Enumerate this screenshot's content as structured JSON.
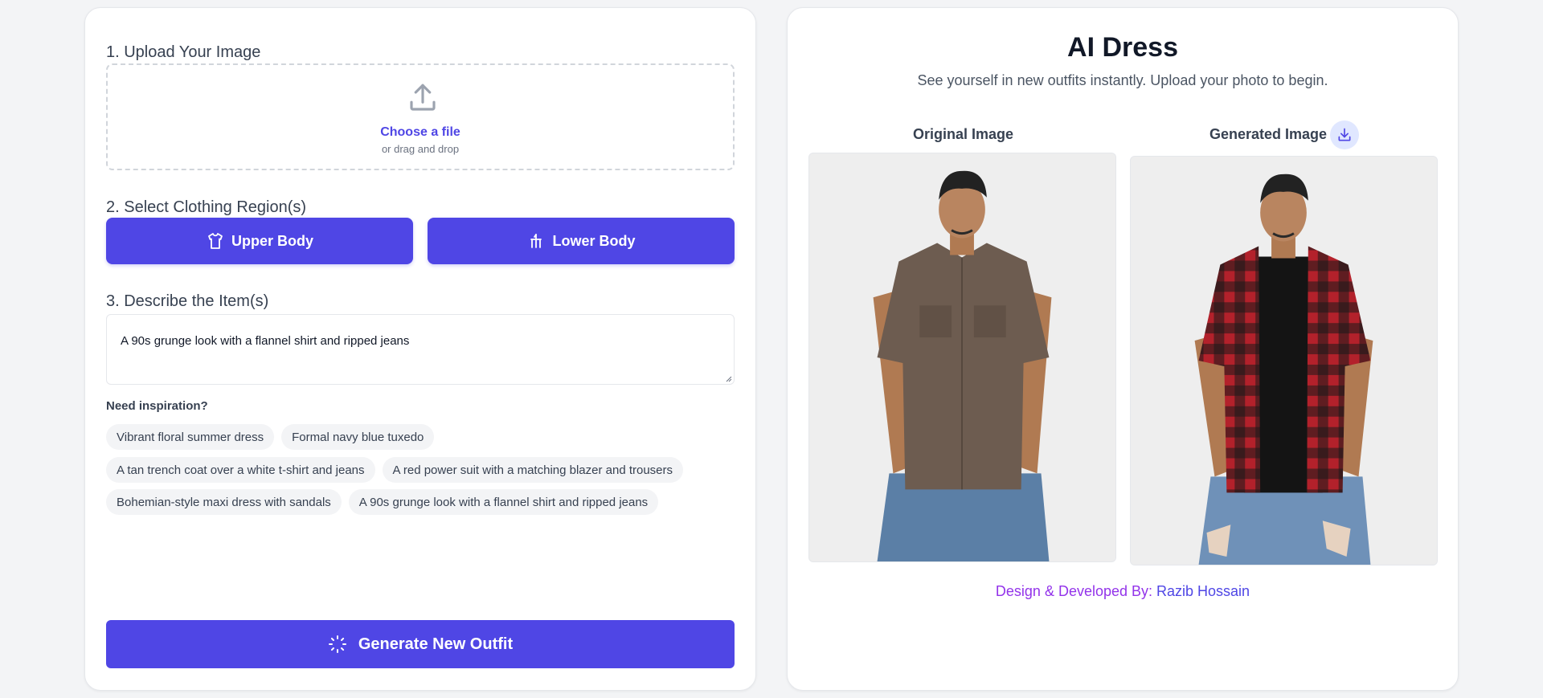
{
  "upload": {
    "title": "1. Upload Your Image",
    "choose_file": "Choose a file",
    "drag_drop": "or drag and drop"
  },
  "regions": {
    "title": "2. Select Clothing Region(s)",
    "upper_label": "Upper Body",
    "lower_label": "Lower Body"
  },
  "describe": {
    "title": "3. Describe the Item(s)",
    "value": "A 90s grunge look with a flannel shirt and ripped jeans"
  },
  "inspiration": {
    "label": "Need inspiration?",
    "chips": [
      "Vibrant floral summer dress",
      "Formal navy blue tuxedo",
      "A tan trench coat over a white t-shirt and jeans",
      "A red power suit with a matching blazer and trousers",
      "Bohemian-style maxi dress with sandals",
      "A 90s grunge look with a flannel shirt and ripped jeans"
    ]
  },
  "generate_label": "Generate New Outfit",
  "header": {
    "title": "AI Dress",
    "subtitle": "See yourself in new outfits instantly. Upload your photo to begin."
  },
  "images": {
    "original_label": "Original Image",
    "generated_label": "Generated Image"
  },
  "footer": {
    "credit_prefix": "Design & Developed By: ",
    "credit_name": "Razib Hossain"
  },
  "icons": {
    "upload": "upload-icon",
    "upper": "shirt-icon",
    "lower": "trousers-icon",
    "generate": "spinner-icon",
    "download": "download-icon"
  },
  "colors": {
    "accent": "#4f46e5",
    "accent_light": "#e0e7ff",
    "credit_purple": "#9333ea"
  }
}
